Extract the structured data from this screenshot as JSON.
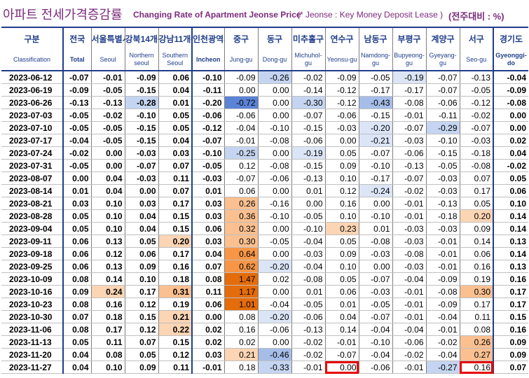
{
  "header": {
    "title_ko": "아파트 전세가격증감률",
    "title_en": "Changing Rate of Apartment Jeonse Price",
    "note": "(* Jeonse : Key Money Deposit Lease )",
    "unit": "(전주대비 : %)"
  },
  "columns": [
    {
      "ko": "구분",
      "en": "Classification"
    },
    {
      "ko": "전국",
      "en": "Total"
    },
    {
      "ko": "서울특별시",
      "en": "Seoul"
    },
    {
      "ko": "강북14개구",
      "en": "Northern seoul"
    },
    {
      "ko": "강남11개구",
      "en": "Southern Seoul"
    },
    {
      "ko": "인천광역시",
      "en": "Incheon"
    },
    {
      "ko": "중구",
      "en": "Jung-gu"
    },
    {
      "ko": "동구",
      "en": "Dong-gu"
    },
    {
      "ko": "미추홀구",
      "en": "Michuhol-gu"
    },
    {
      "ko": "연수구",
      "en": "Yeonsu-gu"
    },
    {
      "ko": "남동구",
      "en": "Namdong-gu"
    },
    {
      "ko": "부평구",
      "en": "Bupyeong-gu"
    },
    {
      "ko": "계양구",
      "en": "Gyeyang-gu"
    },
    {
      "ko": "서구",
      "en": "Seo-gu"
    },
    {
      "ko": "경기도",
      "en": "Gyeonggi-do"
    }
  ],
  "rows": [
    {
      "date": "2023-06-12",
      "values": [
        "-0.07",
        "-0.01",
        "-0.09",
        "0.06",
        "-0.10",
        "-0.09",
        "-0.26",
        "-0.02",
        "-0.09",
        "-0.05",
        "-0.19",
        "-0.07",
        "-0.13",
        "-0.04"
      ]
    },
    {
      "date": "2023-06-19",
      "values": [
        "-0.09",
        "-0.05",
        "-0.15",
        "0.04",
        "-0.11",
        "0.00",
        "0.00",
        "-0.14",
        "-0.12",
        "-0.17",
        "-0.17",
        "-0.07",
        "-0.05",
        "-0.09"
      ]
    },
    {
      "date": "2023-06-26",
      "values": [
        "-0.13",
        "-0.13",
        "-0.28",
        "0.01",
        "-0.20",
        "-0.72",
        "0.00",
        "-0.30",
        "-0.12",
        "-0.43",
        "-0.08",
        "-0.06",
        "-0.12",
        "-0.08"
      ]
    },
    {
      "date": "2023-07-03",
      "values": [
        "-0.05",
        "-0.02",
        "-0.10",
        "0.05",
        "-0.06",
        "-0.06",
        "0.00",
        "-0.07",
        "-0.06",
        "-0.15",
        "-0.01",
        "-0.11",
        "-0.02",
        "0.00"
      ]
    },
    {
      "date": "2023-07-10",
      "values": [
        "-0.05",
        "-0.05",
        "-0.15",
        "0.05",
        "-0.12",
        "-0.04",
        "-0.10",
        "-0.15",
        "-0.03",
        "-0.20",
        "-0.07",
        "-0.29",
        "-0.07",
        "0.00"
      ]
    },
    {
      "date": "2023-07-17",
      "values": [
        "-0.04",
        "-0.05",
        "-0.15",
        "0.04",
        "-0.07",
        "-0.01",
        "-0.08",
        "-0.06",
        "0.00",
        "-0.21",
        "-0.03",
        "-0.10",
        "-0.03",
        "0.02"
      ]
    },
    {
      "date": "2023-07-24",
      "values": [
        "-0.02",
        "0.00",
        "-0.03",
        "0.03",
        "-0.10",
        "-0.25",
        "0.00",
        "-0.19",
        "0.05",
        "-0.07",
        "-0.06",
        "-0.15",
        "-0.18",
        "0.04"
      ]
    },
    {
      "date": "2023-07-31",
      "values": [
        "-0.05",
        "0.00",
        "-0.07",
        "0.07",
        "-0.05",
        "0.12",
        "-0.08",
        "-0.15",
        "0.09",
        "-0.10",
        "-0.13",
        "-0.05",
        "-0.08",
        "-0.02"
      ]
    },
    {
      "date": "2023-08-07",
      "values": [
        "0.00",
        "0.04",
        "-0.03",
        "0.11",
        "-0.03",
        "-0.07",
        "-0.06",
        "-0.13",
        "0.10",
        "-0.17",
        "-0.07",
        "-0.03",
        "0.07",
        "0.05"
      ]
    },
    {
      "date": "2023-08-14",
      "values": [
        "0.01",
        "0.04",
        "0.00",
        "0.07",
        "0.01",
        "0.06",
        "0.00",
        "0.01",
        "0.12",
        "-0.24",
        "-0.02",
        "-0.03",
        "0.17",
        "0.06"
      ]
    },
    {
      "date": "2023-08-21",
      "values": [
        "0.03",
        "0.10",
        "0.03",
        "0.17",
        "0.03",
        "0.26",
        "-0.16",
        "0.00",
        "0.16",
        "0.00",
        "-0.01",
        "-0.13",
        "0.05",
        "0.10"
      ]
    },
    {
      "date": "2023-08-28",
      "values": [
        "0.05",
        "0.10",
        "0.04",
        "0.15",
        "0.03",
        "0.36",
        "-0.10",
        "-0.05",
        "0.10",
        "-0.10",
        "-0.01",
        "-0.18",
        "0.20",
        "0.14"
      ]
    },
    {
      "date": "2023-09-04",
      "values": [
        "0.05",
        "0.10",
        "0.04",
        "0.15",
        "0.06",
        "0.32",
        "0.00",
        "-0.10",
        "0.23",
        "0.01",
        "-0.03",
        "-0.03",
        "0.09",
        "0.14"
      ]
    },
    {
      "date": "2023-09-11",
      "values": [
        "0.06",
        "0.13",
        "0.05",
        "0.20",
        "0.03",
        "0.30",
        "-0.05",
        "-0.04",
        "0.05",
        "-0.08",
        "-0.03",
        "-0.01",
        "0.14",
        "0.13"
      ]
    },
    {
      "date": "2023-09-18",
      "values": [
        "0.06",
        "0.12",
        "0.06",
        "0.17",
        "0.04",
        "0.64",
        "0.00",
        "-0.03",
        "0.09",
        "-0.03",
        "-0.08",
        "-0.01",
        "0.06",
        "0.14"
      ]
    },
    {
      "date": "2023-09-25",
      "values": [
        "0.06",
        "0.13",
        "0.09",
        "0.16",
        "0.07",
        "0.62",
        "-0.20",
        "-0.04",
        "0.10",
        "0.00",
        "-0.03",
        "-0.01",
        "0.16",
        "0.13"
      ]
    },
    {
      "date": "2023-10-09",
      "values": [
        "0.08",
        "0.14",
        "0.10",
        "0.18",
        "0.08",
        "1.47",
        "0.02",
        "-0.08",
        "0.05",
        "-0.07",
        "-0.04",
        "-0.09",
        "0.19",
        "0.16"
      ]
    },
    {
      "date": "2023-10-16",
      "values": [
        "0.09",
        "0.24",
        "0.17",
        "0.31",
        "0.11",
        "1.17",
        "0.00",
        "0.01",
        "0.06",
        "-0.03",
        "-0.01",
        "-0.08",
        "0.30",
        "0.17"
      ]
    },
    {
      "date": "2023-10-23",
      "values": [
        "0.08",
        "0.16",
        "0.12",
        "0.19",
        "0.06",
        "1.01",
        "-0.04",
        "-0.05",
        "0.01",
        "-0.05",
        "-0.01",
        "-0.09",
        "0.17",
        "0.17"
      ]
    },
    {
      "date": "2023-10-30",
      "values": [
        "0.07",
        "0.18",
        "0.15",
        "0.21",
        "0.00",
        "0.08",
        "-0.20",
        "-0.06",
        "0.04",
        "-0.07",
        "-0.01",
        "-0.04",
        "0.11",
        "0.15"
      ]
    },
    {
      "date": "2023-11-06",
      "values": [
        "0.08",
        "0.17",
        "0.12",
        "0.22",
        "0.02",
        "0.16",
        "-0.06",
        "-0.13",
        "0.14",
        "-0.04",
        "-0.04",
        "-0.01",
        "0.08",
        "0.16"
      ]
    },
    {
      "date": "2023-11-13",
      "values": [
        "0.05",
        "0.11",
        "0.07",
        "0.15",
        "0.02",
        "0.02",
        "0.00",
        "-0.02",
        "-0.01",
        "-0.10",
        "-0.06",
        "-0.02",
        "0.26",
        "0.09"
      ]
    },
    {
      "date": "2023-11-20",
      "values": [
        "0.04",
        "0.08",
        "0.05",
        "0.12",
        "0.03",
        "0.21",
        "-0.46",
        "-0.02",
        "-0.07",
        "-0.04",
        "-0.02",
        "-0.04",
        "0.27",
        "0.09"
      ]
    },
    {
      "date": "2023-11-27",
      "values": [
        "0.04",
        "0.10",
        "0.09",
        "0.11",
        "-0.01",
        "0.18",
        "-0.33",
        "-0.01",
        "0.00",
        "-0.06",
        "-0.01",
        "-0.27",
        "0.16",
        "0.07"
      ]
    }
  ],
  "colors": {
    "title": "#7b2a7b",
    "header_text": "#1f3d8a",
    "highlight_box": "#e60000"
  },
  "highlighted_cells": [
    {
      "date": "2023-11-27",
      "column": "연수구"
    },
    {
      "date": "2023-11-27",
      "column": "서구"
    }
  ]
}
